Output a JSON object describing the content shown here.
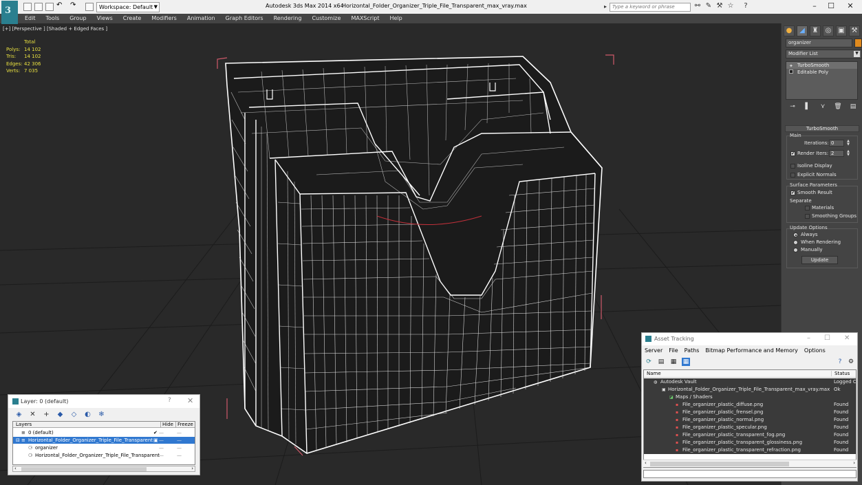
{
  "titlebar": {
    "workspace": "Workspace: Default",
    "app_title": "Autodesk 3ds Max 2014 x64",
    "file_title": "Horizontal_Folder_Organizer_Triple_File_Transparent_max_vray.max",
    "search_placeholder": "Type a keyword or phrase"
  },
  "menu": [
    "Edit",
    "Tools",
    "Group",
    "Views",
    "Create",
    "Modifiers",
    "Animation",
    "Graph Editors",
    "Rendering",
    "Customize",
    "MAXScript",
    "Help"
  ],
  "viewport": {
    "label": "[+] [Perspective ] [Shaded + Edged Faces ]",
    "stats_header": "Total",
    "stats": [
      {
        "label": "Polys:",
        "value": "14 102"
      },
      {
        "label": "Tris:",
        "value": "14 102"
      },
      {
        "label": "Edges:",
        "value": "42 306"
      },
      {
        "label": "Verts:",
        "value": "7 035"
      }
    ]
  },
  "command_panel": {
    "object_name": "organizer",
    "object_color": "#e08a1e",
    "modifier_list": "Modifier List",
    "stack": [
      "TurboSmooth",
      "Editable Poly"
    ],
    "rollout_title": "TurboSmooth",
    "main_group": "Main",
    "iterations_label": "Iterations:",
    "iterations_value": "0",
    "render_iters_label": "Render Iters:",
    "render_iters_value": "2",
    "isoline_label": "Isoline Display",
    "explicit_normals_label": "Explicit Normals",
    "surface_group": "Surface Parameters",
    "smooth_result_label": "Smooth Result",
    "separate_label": "Separate",
    "materials_label": "Materials",
    "smoothing_groups_label": "Smoothing Groups",
    "update_group": "Update Options",
    "always_label": "Always",
    "when_rendering_label": "When Rendering",
    "manually_label": "Manually",
    "update_button": "Update"
  },
  "layers_dialog": {
    "title": "Layer: 0 (default)",
    "help": "?",
    "close": "✕",
    "columns": [
      "Layers",
      "Hide",
      "Freeze"
    ],
    "rows": [
      {
        "name": "0 (default)",
        "checked": "✔"
      },
      {
        "name": "Horizontal_Folder_Organizer_Triple_File_Transparent"
      },
      {
        "name": "organizer"
      },
      {
        "name": "Horizontal_Folder_Organizer_Triple_File_Transparent"
      }
    ],
    "dash": "—"
  },
  "asset_tracking": {
    "title": "Asset Tracking",
    "menu": [
      "Server",
      "File",
      "Paths",
      "Bitmap Performance and Memory",
      "Options"
    ],
    "columns": [
      "Name",
      "Status"
    ],
    "rows": [
      {
        "name": "Autodesk Vault",
        "status": "Logged O"
      },
      {
        "name": "Horizontal_Folder_Organizer_Triple_File_Transparent_max_vray.max",
        "status": "Ok"
      },
      {
        "name": "Maps / Shaders",
        "status": ""
      },
      {
        "name": "File_organizer_plastic_diffuse.png",
        "status": "Found"
      },
      {
        "name": "File_organizer_plastic_frensel.png",
        "status": "Found"
      },
      {
        "name": "File_organizer_plastic_normal.png",
        "status": "Found"
      },
      {
        "name": "File_organizer_plastic_specular.png",
        "status": "Found"
      },
      {
        "name": "File_organizer_plastic_transparent_fog.png",
        "status": "Found"
      },
      {
        "name": "File_organizer_plastic_transparent_glossiness.png",
        "status": "Found"
      },
      {
        "name": "File_organizer_plastic_transparent_refraction.png",
        "status": "Found"
      }
    ]
  }
}
